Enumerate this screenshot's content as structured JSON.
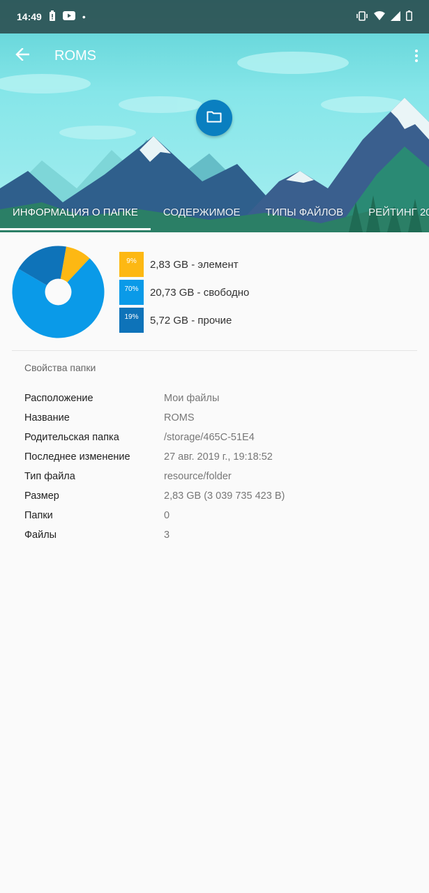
{
  "status_bar": {
    "time": "14:49",
    "dot": "•",
    "icons": [
      "battery-alert-icon",
      "youtube-icon",
      "vibrate-icon",
      "wifi-icon",
      "signal-icon",
      "battery-icon"
    ]
  },
  "toolbar": {
    "title": "ROMS"
  },
  "tabs": [
    {
      "label": "ИНФОРМАЦИЯ О ПАПКЕ",
      "active": true
    },
    {
      "label": "СОДЕРЖИМОЕ",
      "active": false
    },
    {
      "label": "ТИПЫ ФАЙЛОВ",
      "active": false
    },
    {
      "label": "РЕЙТИНГ 20",
      "active": false
    }
  ],
  "storage": {
    "segments": [
      {
        "percent_label": "9%",
        "text": "2,83 GB - элемент",
        "value": 9,
        "color": "#fdb813"
      },
      {
        "percent_label": "70%",
        "text": "20,73 GB - свободно",
        "value": 70,
        "color": "#0a9ae8"
      },
      {
        "percent_label": "19%",
        "text": "5,72 GB - прочие",
        "value": 19,
        "color": "#0e73b9"
      }
    ]
  },
  "properties": {
    "title": "Свойства папки",
    "rows": [
      {
        "label": "Расположение",
        "value": "Мои файлы"
      },
      {
        "label": "Название",
        "value": "ROMS"
      },
      {
        "label": "Родительская папка",
        "value": "/storage/465C-51E4"
      },
      {
        "label": "Последнее изменение",
        "value": "27 авг. 2019 г., 19:18:52"
      },
      {
        "label": "Тип файла",
        "value": "resource/folder"
      },
      {
        "label": "Размер",
        "value": "2,83 GB (3 039 735 423 B)"
      },
      {
        "label": "Папки",
        "value": "0"
      },
      {
        "label": "Файлы",
        "value": "3"
      }
    ]
  }
}
